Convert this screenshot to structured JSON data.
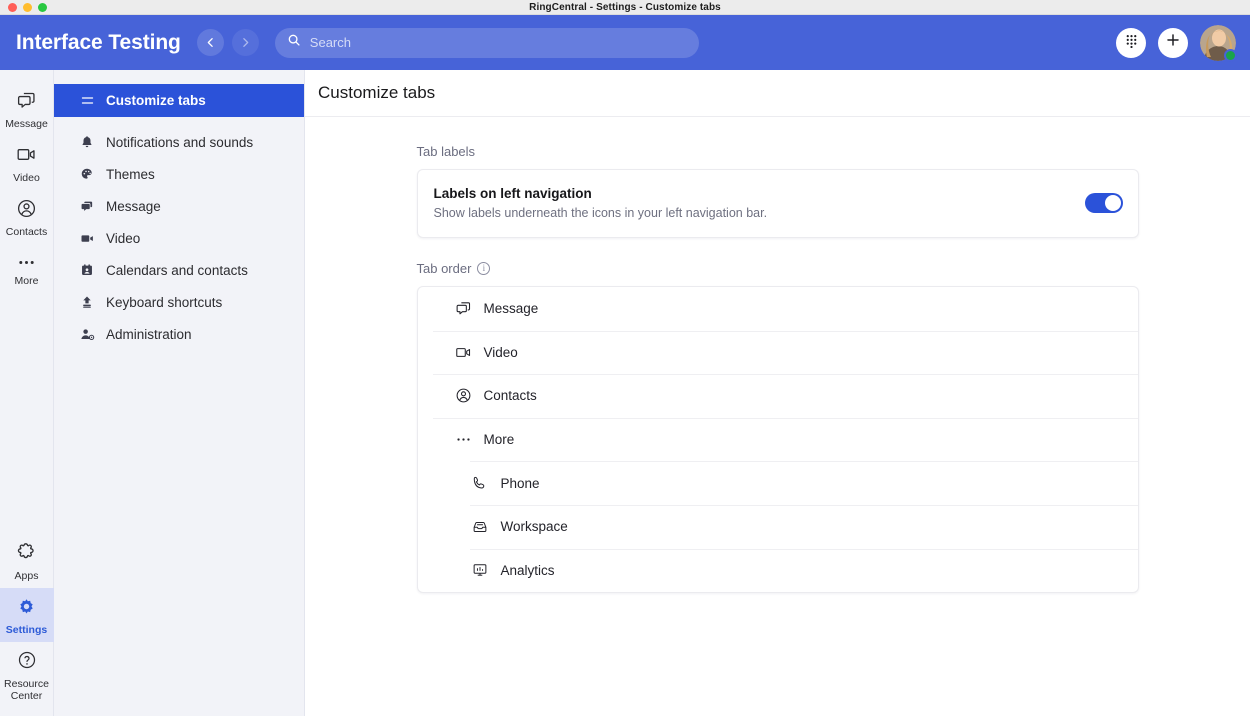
{
  "window": {
    "title": "RingCentral - Settings - Customize tabs",
    "traffic_lights": [
      "close",
      "minimize",
      "maximize"
    ]
  },
  "header": {
    "app_title": "Interface Testing",
    "back_icon": "chevron-left-icon",
    "forward_icon": "chevron-right-icon",
    "search": {
      "icon": "search-icon",
      "placeholder": "Search",
      "value": ""
    },
    "dialpad_icon": "dialpad-icon",
    "add_icon": "plus-icon",
    "avatar": "user-avatar",
    "presence": "available",
    "accent_color": "#4763d8"
  },
  "rail": {
    "items": [
      {
        "label": "Message",
        "icon": "message-icon",
        "active": false
      },
      {
        "label": "Video",
        "icon": "video-icon",
        "active": false
      },
      {
        "label": "Contacts",
        "icon": "contacts-icon",
        "active": false
      },
      {
        "label": "More",
        "icon": "more-dots-icon",
        "active": false
      }
    ],
    "bottom_items": [
      {
        "label": "Apps",
        "icon": "apps-puzzle-icon",
        "active": false
      },
      {
        "label": "Settings",
        "icon": "gear-icon",
        "active": true
      },
      {
        "label": "Resource Center",
        "icon": "help-circle-icon",
        "active": false
      }
    ],
    "active_color": "#2d5bd7",
    "active_bg": "#d6dcf7"
  },
  "settings_nav": {
    "items": [
      {
        "label": "Customize tabs",
        "icon": "hamburger-icon",
        "active": true
      },
      {
        "label": "Notifications and sounds",
        "icon": "bell-icon",
        "active": false
      },
      {
        "label": "Themes",
        "icon": "palette-icon",
        "active": false
      },
      {
        "label": "Message",
        "icon": "message-icon",
        "active": false
      },
      {
        "label": "Video",
        "icon": "video-icon",
        "active": false
      },
      {
        "label": "Calendars and contacts",
        "icon": "calendar-icon",
        "active": false
      },
      {
        "label": "Keyboard shortcuts",
        "icon": "keyboard-shortcut-icon",
        "active": false
      },
      {
        "label": "Administration",
        "icon": "admin-user-icon",
        "active": false
      }
    ],
    "active_bg": "#2b52d9"
  },
  "main": {
    "page_title": "Customize tabs",
    "tab_labels_section": {
      "section_label": "Tab labels",
      "setting_title": "Labels on left navigation",
      "setting_description": "Show labels underneath the icons in your left navigation bar.",
      "toggle_state": "on",
      "toggle_color": "#2b52d9"
    },
    "tab_order_section": {
      "section_label": "Tab order",
      "info_icon": "info-icon",
      "info_glyph": "i",
      "rows": [
        {
          "label": "Message",
          "icon": "message-icon",
          "nested": false
        },
        {
          "label": "Video",
          "icon": "video-icon",
          "nested": false
        },
        {
          "label": "Contacts",
          "icon": "contacts-icon",
          "nested": false
        },
        {
          "label": "More",
          "icon": "more-dots-icon",
          "nested": false
        },
        {
          "label": "Phone",
          "icon": "phone-icon",
          "nested": true
        },
        {
          "label": "Workspace",
          "icon": "workspace-inbox-icon",
          "nested": true
        },
        {
          "label": "Analytics",
          "icon": "analytics-icon",
          "nested": true
        }
      ]
    }
  }
}
